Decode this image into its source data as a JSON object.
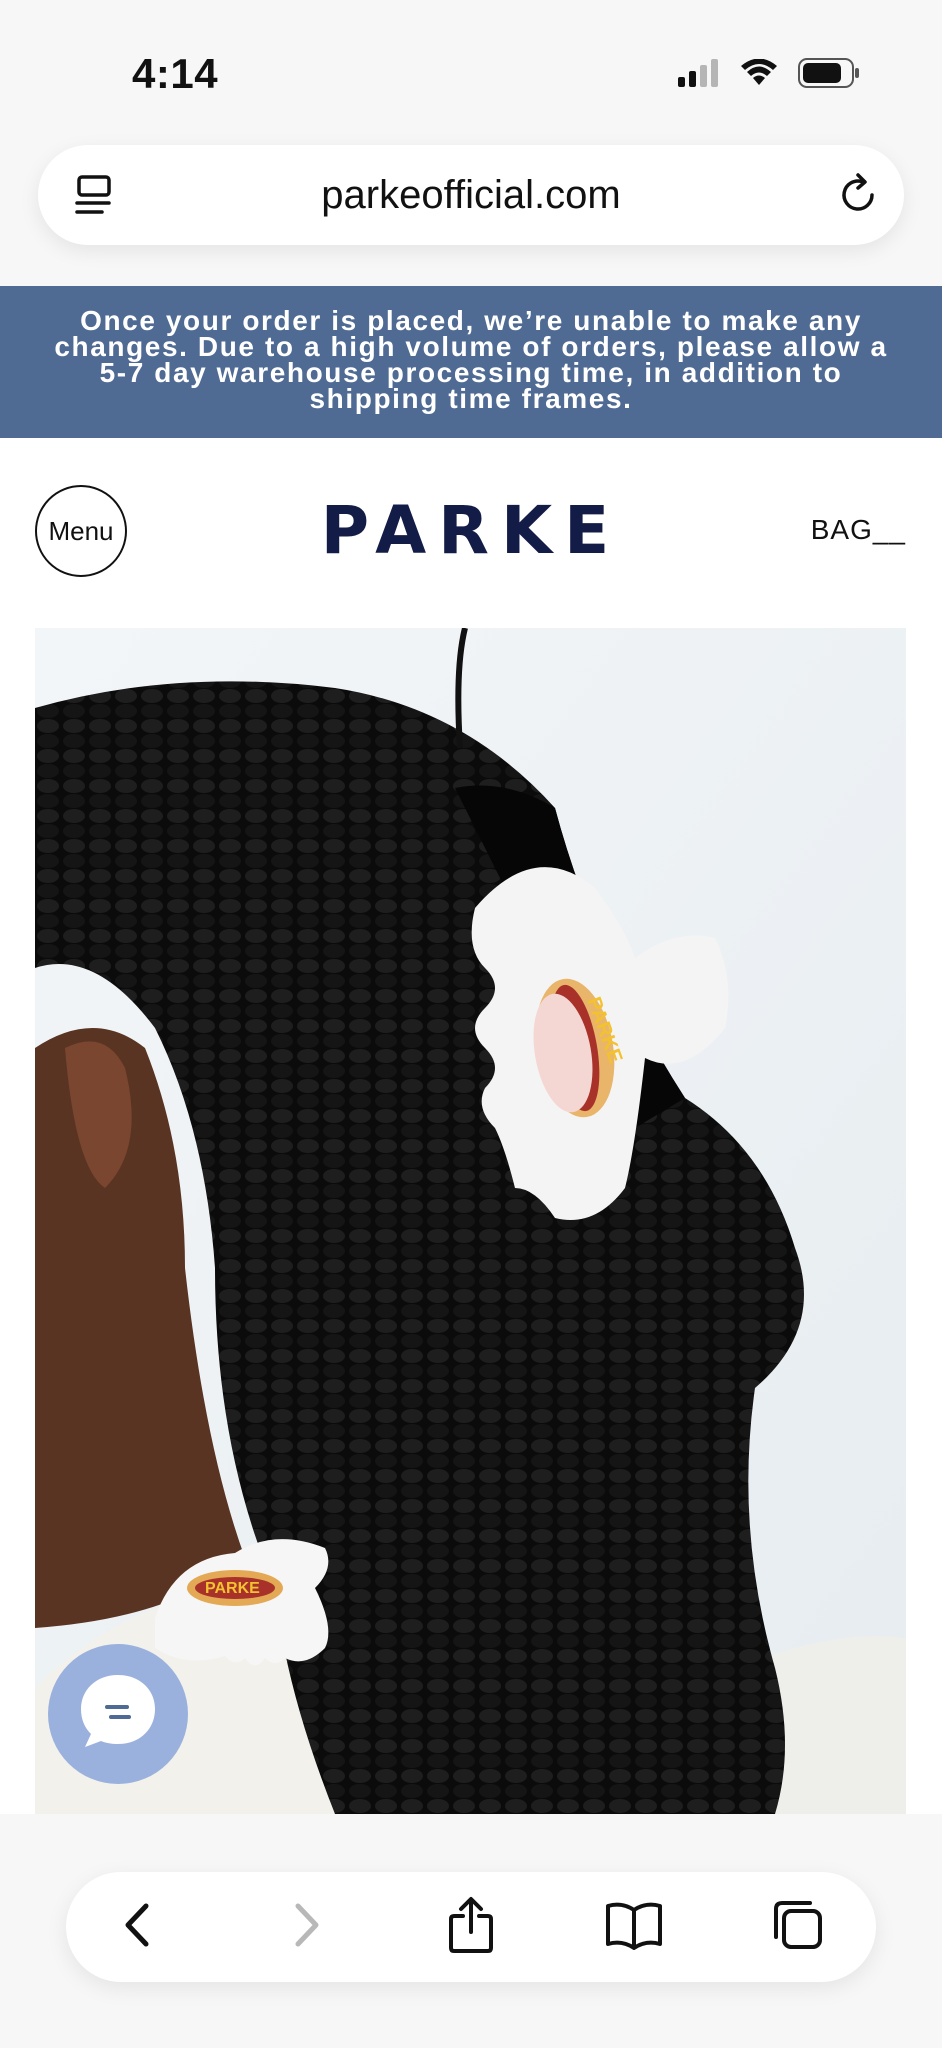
{
  "status_bar": {
    "time": "4:14"
  },
  "browser": {
    "url": "parkeofficial.com"
  },
  "banner": {
    "text": "Once your order is placed, we’re unable to make any changes. Due to a high volume of orders, please allow a 5-7 day warehouse processing time, in addition to shipping time frames."
  },
  "header": {
    "menu_label": "Menu",
    "logo": "PARKE",
    "bag_label": "BAG__"
  },
  "hero": {
    "clip_print_text": "PARKE"
  },
  "colors": {
    "banner_bg": "#4f6a93",
    "logo": "#131c46",
    "chat_bubble": "#9bb1dd"
  },
  "icons": {
    "url_left": "page-menu-icon",
    "url_right": "reload-icon",
    "chat": "chat-bubble-icon",
    "toolbar": [
      "back-icon",
      "forward-icon",
      "share-icon",
      "bookmarks-icon",
      "tabs-icon"
    ]
  }
}
